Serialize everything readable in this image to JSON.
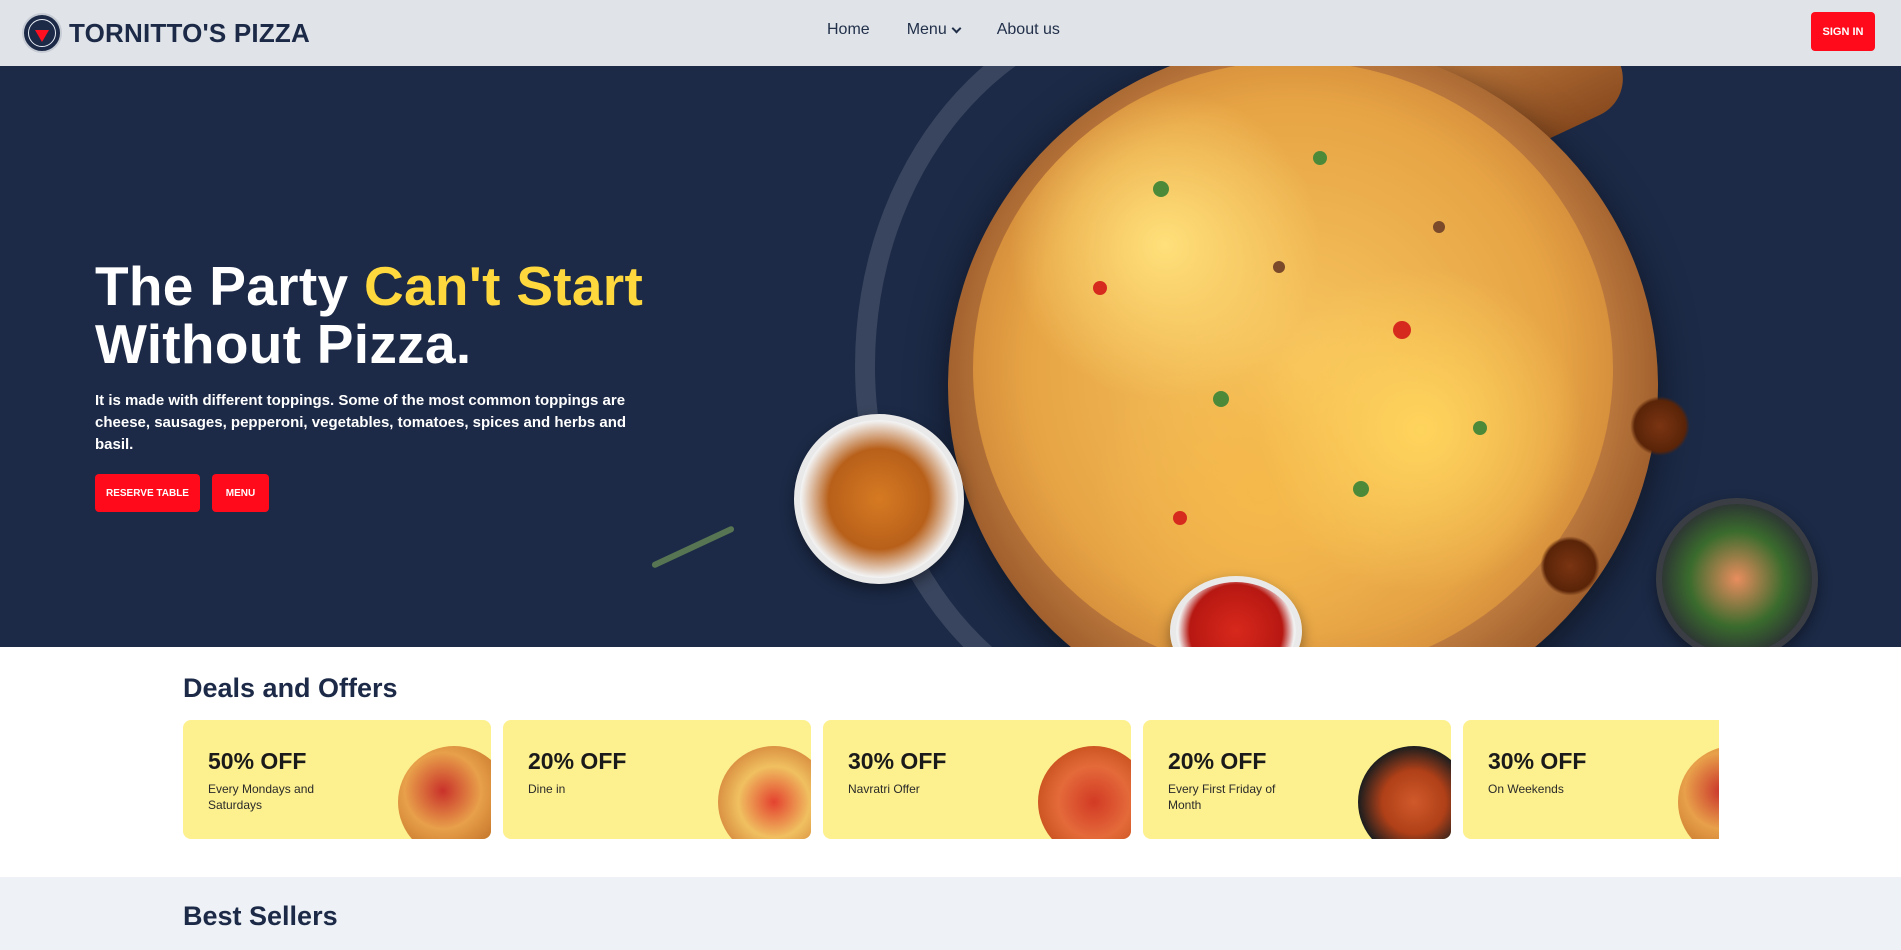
{
  "brand": {
    "name": "TORNITTO'S PIZZA",
    "logo_icon": "pizza-logo-icon"
  },
  "nav": {
    "links": [
      {
        "label": "Home"
      },
      {
        "label": "Menu",
        "has_dropdown": true
      },
      {
        "label": "About us"
      }
    ],
    "signin_label": "SIGN IN"
  },
  "hero": {
    "title_part1": "The Party ",
    "title_accent": "Can't Start",
    "title_part2": "Without Pizza.",
    "description": "It is made with different toppings. Some of the most common toppings are cheese, sausages, pepperoni, vegetables, tomatoes, spices and herbs and basil.",
    "reserve_label": "RESERVE TABLE",
    "menu_label": "MENU"
  },
  "deals": {
    "title": "Deals and Offers",
    "items": [
      {
        "percent": "50% OFF",
        "desc": "Every Mondays and Saturdays"
      },
      {
        "percent": "20% OFF",
        "desc": "Dine in"
      },
      {
        "percent": "30% OFF",
        "desc": "Navratri Offer"
      },
      {
        "percent": "20% OFF",
        "desc": "Every First Friday of Month"
      },
      {
        "percent": "30% OFF",
        "desc": "On Weekends"
      }
    ]
  },
  "bestsellers": {
    "title": "Best Sellers"
  },
  "colors": {
    "navy": "#1c2a47",
    "accent_yellow": "#ffd83d",
    "cta_red": "#ff0a1a",
    "deal_card": "#fdf08e"
  }
}
